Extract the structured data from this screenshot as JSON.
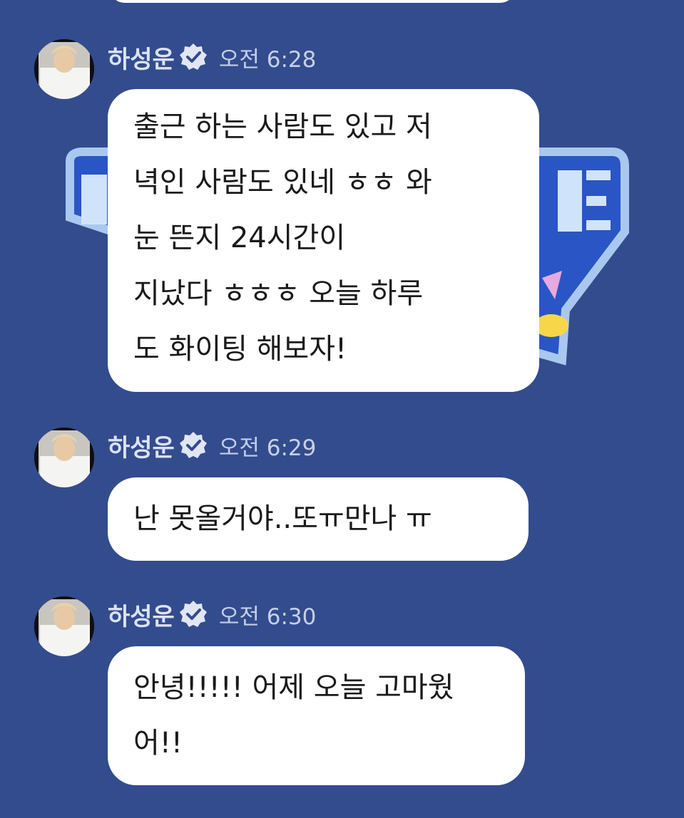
{
  "messages": [
    {
      "author": "하성운",
      "time": "오전 6:28",
      "lines": [
        "출근 하는 사람도 있고 저",
        "녁인 사람도 있네 ㅎㅎ 와",
        "눈 뜬지 24시간이",
        "지났다 ㅎㅎㅎ 오늘 하루",
        "도 화이팅 해보자!"
      ]
    },
    {
      "author": "하성운",
      "time": "오전 6:29",
      "lines": [
        "난 못올거야..또ㅠ만나 ㅠ"
      ]
    },
    {
      "author": "하성운",
      "time": "오전 6:30",
      "lines": [
        "안녕!!!!! 어제 오늘 고마웠",
        "어!!"
      ]
    }
  ],
  "colors": {
    "background": "#334c8e",
    "bubble": "#ffffff",
    "text": "#1a1a1a",
    "name": "#dbe2f3"
  }
}
